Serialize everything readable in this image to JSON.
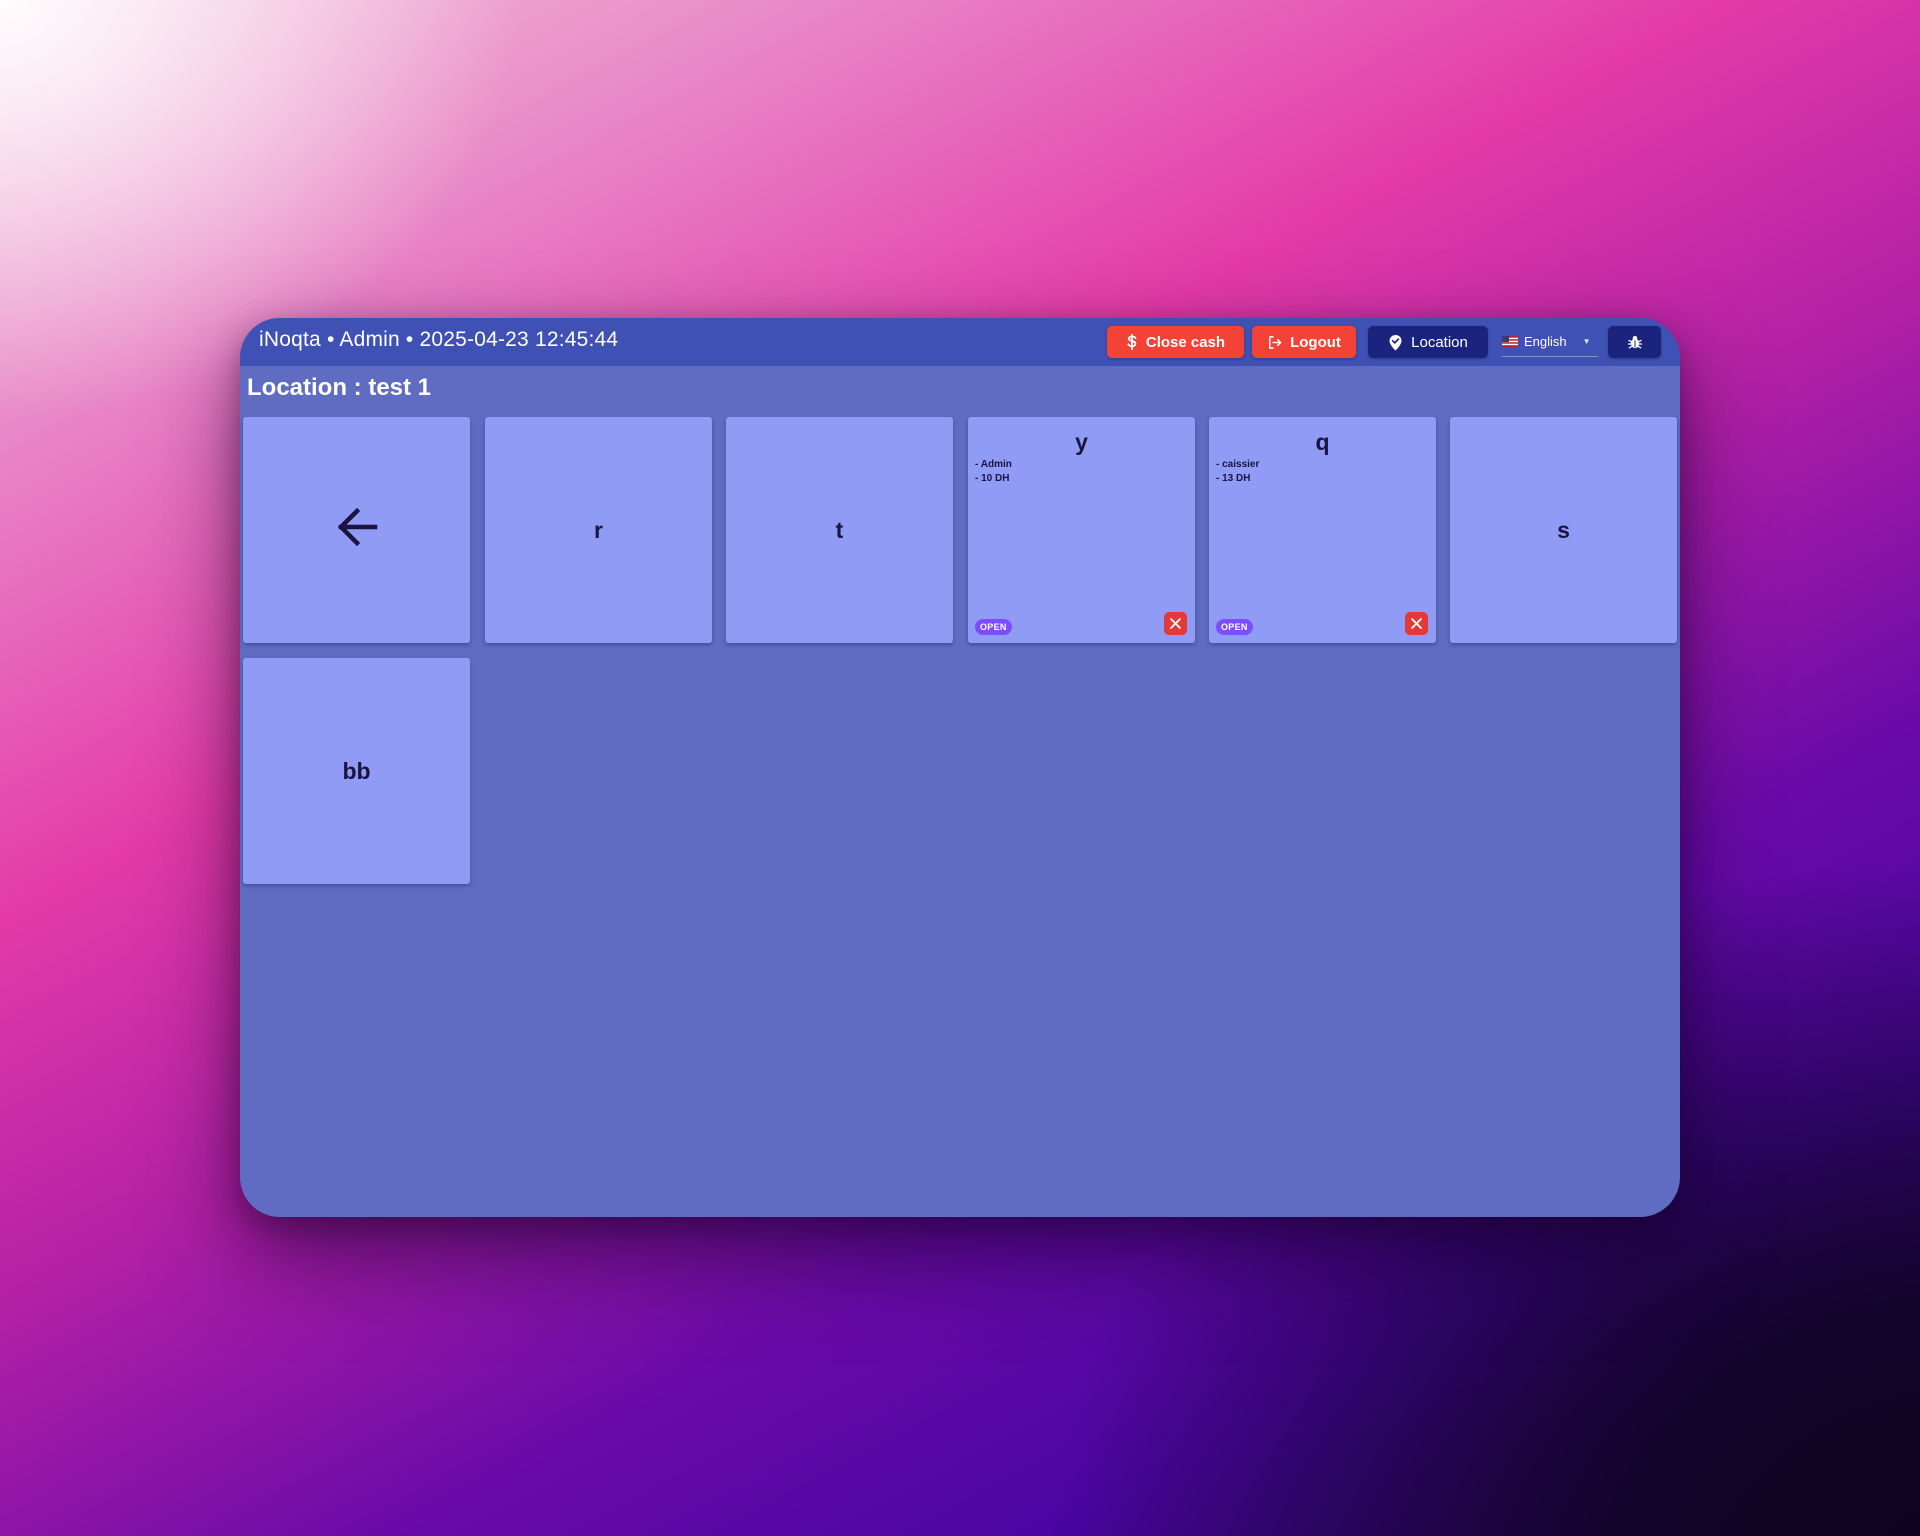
{
  "header": {
    "title": "iNoqta • Admin • 2025-04-23 12:45:44",
    "close_cash_label": "Close cash",
    "logout_label": "Logout",
    "location_label": "Location",
    "language_label": "English"
  },
  "location_heading": "Location : test 1",
  "tiles": [
    {
      "name": "r"
    },
    {
      "name": "t"
    },
    {
      "name": "y",
      "lines": [
        "- Admin",
        "- 10 DH"
      ],
      "status": "OPEN"
    },
    {
      "name": "q",
      "lines": [
        "- caissier",
        "- 13 DH"
      ],
      "status": "OPEN"
    },
    {
      "name": "s"
    },
    {
      "name": "bb"
    }
  ],
  "icons": {
    "back": "arrow-left-icon",
    "close_cash": "dollar-icon",
    "logout": "logout-icon",
    "location": "location-check-icon",
    "language": "us-flag-icon",
    "debug": "bug-icon",
    "tile_close": "close-x-icon"
  },
  "colors": {
    "topbar": "#3f51b5",
    "background": "#5f6cc2",
    "tile": "#8f9bf4",
    "danger": "#f44336",
    "navy": "#1a237e",
    "badge": "#7c4dff"
  }
}
